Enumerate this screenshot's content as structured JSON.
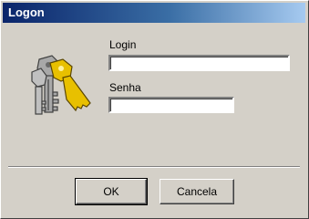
{
  "window": {
    "title": "Logon",
    "titlebar_colors": {
      "start": "#0a246a",
      "end": "#a6caf0"
    }
  },
  "icon": {
    "name": "keys-icon",
    "colors": {
      "gold_key": "#e8c000",
      "gray_key": "#a0a0a0"
    }
  },
  "form": {
    "login_label": "Login",
    "login_value": "",
    "password_label": "Senha",
    "password_value": ""
  },
  "buttons": {
    "ok_label": "OK",
    "cancel_label": "Cancela"
  }
}
